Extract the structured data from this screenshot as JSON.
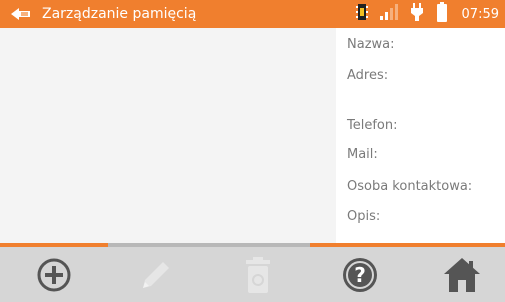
{
  "header": {
    "title": "Zarządzanie pamięcią",
    "time": "07:59",
    "icons": [
      "back-arrow-icon",
      "memory-chip-icon",
      "signal-bars-icon",
      "power-plug-icon",
      "battery-icon"
    ]
  },
  "form": {
    "labels": {
      "name": "Nazwa:",
      "address": "Adres:",
      "phone": "Telefon:",
      "mail": "Mail:",
      "contact": "Osoba kontaktowa:",
      "description": "Opis:"
    }
  },
  "toolbar": {
    "buttons": [
      {
        "icon": "add-circle-icon",
        "enabled": true
      },
      {
        "icon": "pencil-icon",
        "enabled": false
      },
      {
        "icon": "trash-icon",
        "enabled": false
      },
      {
        "icon": "help-icon",
        "enabled": true
      },
      {
        "icon": "home-icon",
        "enabled": true
      }
    ]
  },
  "colors": {
    "accent": "#f07f2e",
    "toolbar_bg": "#d6d6d6",
    "icon_active": "#555555",
    "icon_disabled": "#e6e6e6",
    "tab_inactive": "#b8b8b8"
  }
}
